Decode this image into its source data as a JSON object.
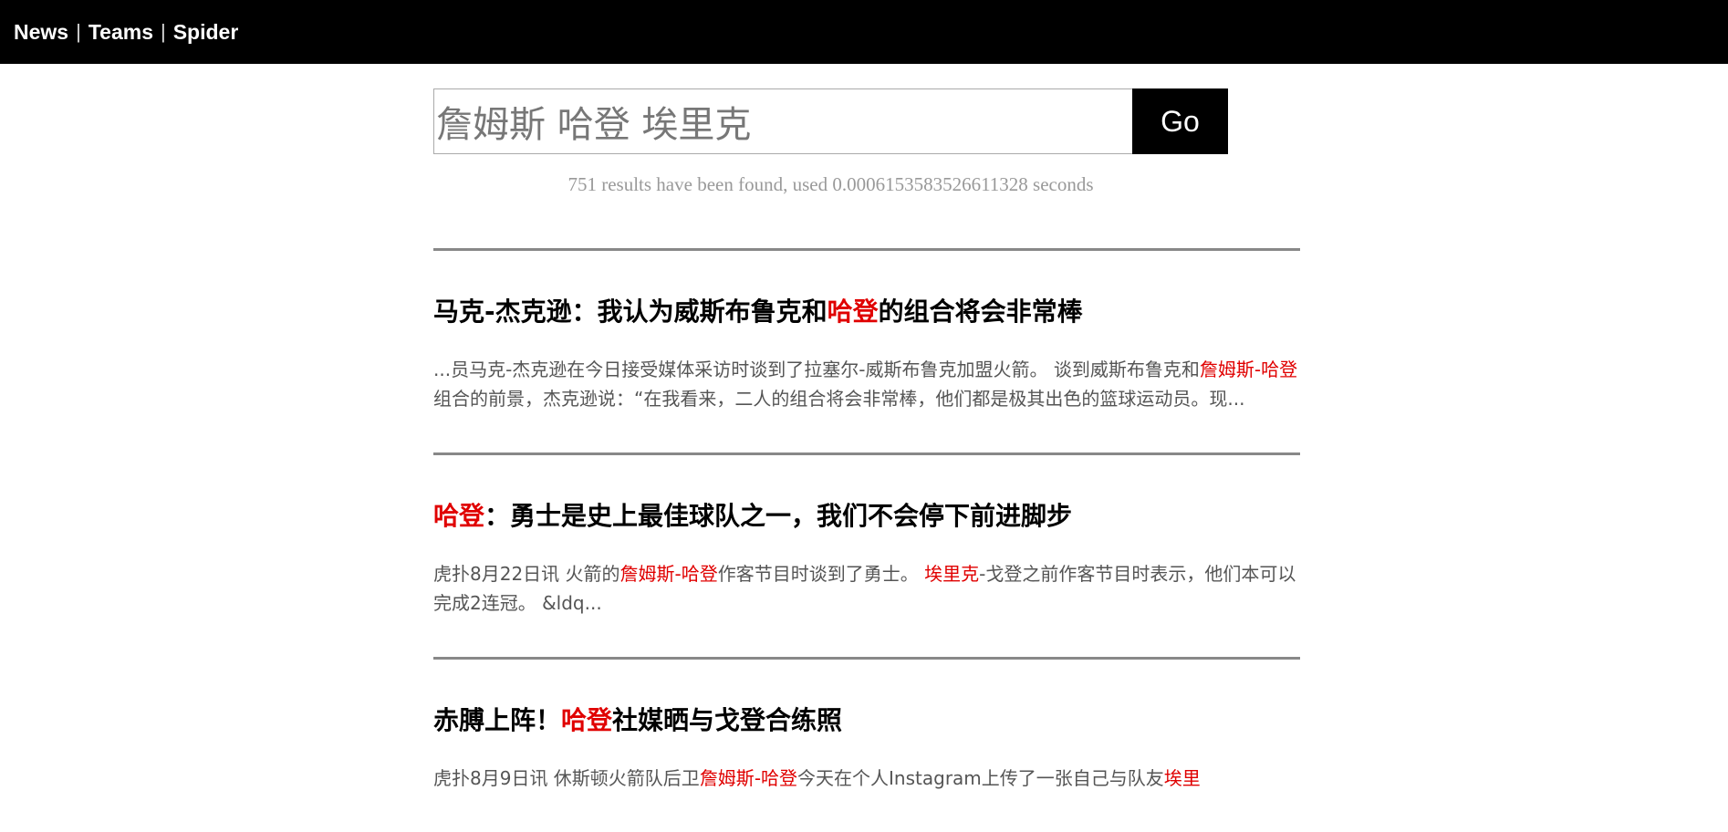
{
  "nav": {
    "items": [
      {
        "label": "News"
      },
      {
        "label": "Teams"
      },
      {
        "label": "Spider"
      }
    ],
    "separator": "|"
  },
  "search": {
    "value": "詹姆斯 哈登 埃里克",
    "placeholder": "",
    "button_label": "Go"
  },
  "stats": {
    "text": "751 results have been found, used 0.0006153583526611328 seconds"
  },
  "results": [
    {
      "title": [
        {
          "text": "马克-杰克逊：我认为威斯布鲁克和",
          "hl": false
        },
        {
          "text": "哈登",
          "hl": true
        },
        {
          "text": "的组合将会非常棒",
          "hl": false
        }
      ],
      "snippet": [
        {
          "text": "...员马克-杰克逊在今日接受媒体采访时谈到了拉塞尔-威斯布鲁克加盟火箭。 谈到威斯布鲁克和",
          "hl": false
        },
        {
          "text": "詹姆斯",
          "hl": true
        },
        {
          "text": "-",
          "hl": true
        },
        {
          "text": "哈登",
          "hl": true
        },
        {
          "text": "组合的前景，杰克逊说：“在我看来，二人的组合将会非常棒，他们都是极其出色的篮球运动员。现...",
          "hl": false
        }
      ]
    },
    {
      "title": [
        {
          "text": "哈登",
          "hl": true
        },
        {
          "text": "：勇士是史上最佳球队之一，我们不会停下前进脚步",
          "hl": false
        }
      ],
      "snippet": [
        {
          "text": "虎扑8月22日讯 火箭的",
          "hl": false
        },
        {
          "text": "詹姆斯",
          "hl": true
        },
        {
          "text": "-",
          "hl": true
        },
        {
          "text": "哈登",
          "hl": true
        },
        {
          "text": "作客节目时谈到了勇士。 ",
          "hl": false
        },
        {
          "text": "埃里克",
          "hl": true
        },
        {
          "text": "-戈登之前作客节目时表示，他们本可以完成2连冠。 &ldq...",
          "hl": false
        }
      ]
    },
    {
      "title": [
        {
          "text": "赤膊上阵！",
          "hl": false
        },
        {
          "text": "哈登",
          "hl": true
        },
        {
          "text": "社媒晒与戈登合练照",
          "hl": false
        }
      ],
      "snippet": [
        {
          "text": "虎扑8月9日讯 休斯顿火箭队后卫",
          "hl": false
        },
        {
          "text": "詹姆斯",
          "hl": true
        },
        {
          "text": "-",
          "hl": true
        },
        {
          "text": "哈登",
          "hl": true
        },
        {
          "text": "今天在个人Instagram上传了一张自己与队友",
          "hl": false
        },
        {
          "text": "埃里",
          "hl": true
        }
      ]
    }
  ],
  "colors": {
    "topbar_bg": "#000000",
    "highlight": "#e00000",
    "divider": "#888888",
    "stats_text": "#999999"
  }
}
